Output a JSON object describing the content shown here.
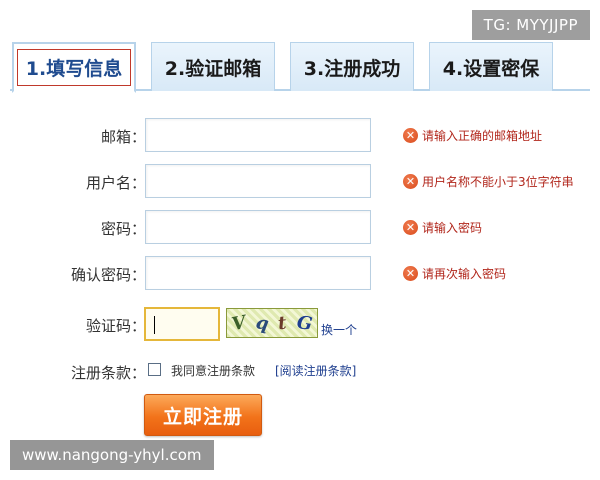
{
  "watermark_top": "TG: MYYJJPP",
  "watermark_bottom": "www.nangong-yhyl.com",
  "tabs": [
    {
      "label": "1.填写信息"
    },
    {
      "label": "2.验证邮箱"
    },
    {
      "label": "3.注册成功"
    },
    {
      "label": "4.设置密保"
    }
  ],
  "form": {
    "email": {
      "label": "邮箱：",
      "value": "",
      "error": "请输入正确的邮箱地址"
    },
    "username": {
      "label": "用户名：",
      "value": "",
      "error": "用户名称不能小于3位字符串"
    },
    "password": {
      "label": "密码：",
      "value": "",
      "error": "请输入密码"
    },
    "confirm": {
      "label": "确认密码：",
      "value": "",
      "error": "请再次输入密码"
    },
    "captcha": {
      "label": "验证码：",
      "value": "",
      "chars": [
        "V",
        "q",
        "t",
        "G"
      ],
      "refresh": "换一个"
    },
    "terms": {
      "label": "注册条款：",
      "agree": "我同意注册条款",
      "link": "[阅读注册条款]",
      "checked": false
    },
    "submit": "立即注册"
  },
  "colors": {
    "accent": "#f2731a",
    "error": "#b1261b",
    "tab_border": "#b7d3ea",
    "link": "#1f3f8f"
  }
}
